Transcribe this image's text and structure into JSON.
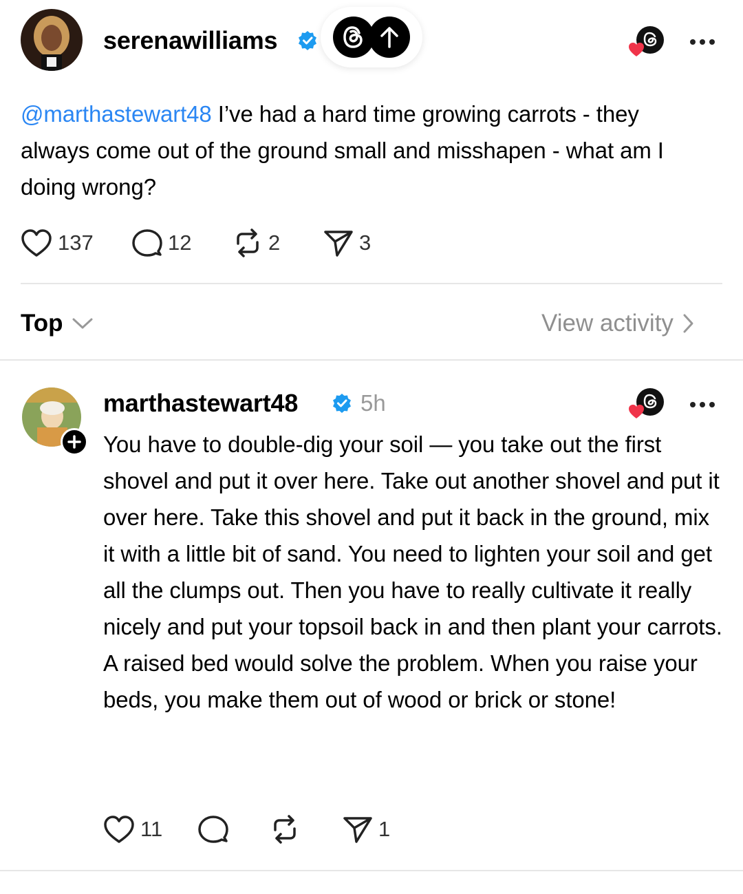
{
  "post": {
    "username": "serenawilliams",
    "mention": "@marthastewart48",
    "text": " I’ve had a hard time growing carrots - they always come out of the ground small and misshapen - what am I doing wrong?",
    "likes": "137",
    "comments": "12",
    "reposts": "2",
    "shares": "3"
  },
  "sort": {
    "label": "Top",
    "view_activity": "View activity"
  },
  "reply": {
    "username": "marthastewart48",
    "time": "5h",
    "text": "You have to double-dig your soil — you take out the first shovel and put it over here. Take out another shovel and put it over here. Take this shovel and put it back in the ground, mix it with a little bit of sand. You need to lighten your soil and get all the clumps out. Then you have to really cultivate it really nicely and put your topsoil back in and then plant your carrots. A raised bed would solve the problem. When you raise your beds, you make them out of wood or brick or stone!",
    "likes": "11",
    "comments": "",
    "reposts": "",
    "shares": "1"
  },
  "colors": {
    "accent": "#2a86f3",
    "verified": "#1d9bf0",
    "heart": "#f0344a"
  }
}
